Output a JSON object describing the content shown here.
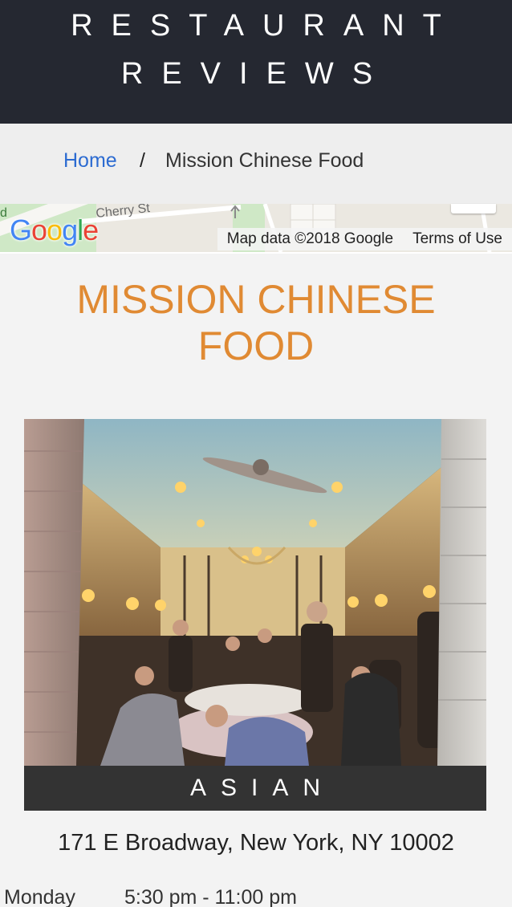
{
  "header": {
    "title_line1": "RESTAURANT",
    "title_line2": "REVIEWS"
  },
  "breadcrumb": {
    "home": "Home",
    "separator": "/",
    "current": "Mission Chinese Food"
  },
  "map": {
    "street_label": "Cherry St",
    "logo": {
      "letters": [
        "G",
        "o",
        "o",
        "g",
        "l",
        "e"
      ],
      "colors": [
        "#4285F4",
        "#EA4335",
        "#FBBC05",
        "#4285F4",
        "#34A853",
        "#EA4335"
      ]
    },
    "attribution": "Map data ©2018 Google",
    "terms": "Terms of Use"
  },
  "restaurant": {
    "name": "MISSION CHINESE FOOD",
    "cuisine": "ASIAN",
    "address": "171 E Broadway, New York, NY 10002",
    "hours": [
      {
        "day": "Monday",
        "time": "5:30 pm - 11:00 pm"
      }
    ]
  },
  "colors": {
    "header_bg": "#252831",
    "accent": "#e08a33",
    "link": "#2c6bd1",
    "cuisine_bg": "#333333"
  }
}
